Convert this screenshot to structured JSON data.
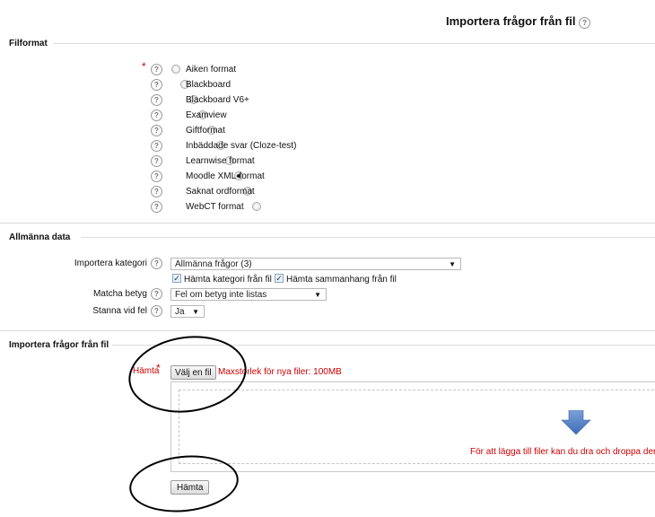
{
  "page": {
    "title": "Importera frågor från fil"
  },
  "help_glyph": "?",
  "required_glyph": "*",
  "file_format": {
    "legend": "Filformat",
    "options": [
      {
        "label": "Aiken format",
        "checked": false
      },
      {
        "label": "Blackboard",
        "checked": false
      },
      {
        "label": "Blackboard V6+",
        "checked": false
      },
      {
        "label": "Examview",
        "checked": false
      },
      {
        "label": "Giftformat",
        "checked": false
      },
      {
        "label": "Inbäddade svar (Cloze-test)",
        "checked": false
      },
      {
        "label": "Learnwise format",
        "checked": false
      },
      {
        "label": "Moodle XML-format",
        "checked": true
      },
      {
        "label": "Saknat ordformat",
        "checked": false
      },
      {
        "label": "WebCT format",
        "checked": false
      }
    ]
  },
  "general": {
    "legend": "Allmänna data",
    "category_label": "Importera kategori",
    "category_value": "Allmänna frågor (3)",
    "cat_from_file": "Hämta kategori från fil",
    "context_from_file": "Hämta sammanhang från fil",
    "check_glyph": "✓",
    "match_grade_label": "Matcha betyg",
    "match_grade_value": "Fel om betyg inte listas",
    "stop_on_error_label": "Stanna vid fel",
    "stop_on_error_value": "Ja",
    "dropdown_glyph": "▼"
  },
  "import": {
    "legend": "Importera frågor från fil",
    "file_label": "Hämta",
    "choose_file_button": "Välj en fil",
    "max_size": "Maxstorlek för nya filer: 100MB",
    "drop_hint": "För att lägga till filer kan du dra och droppa dem här.",
    "submit_button": "Hämta"
  },
  "colors": {
    "accent_arrow": "#5b86c5",
    "required": "#d00000",
    "hint": "#c00000"
  }
}
